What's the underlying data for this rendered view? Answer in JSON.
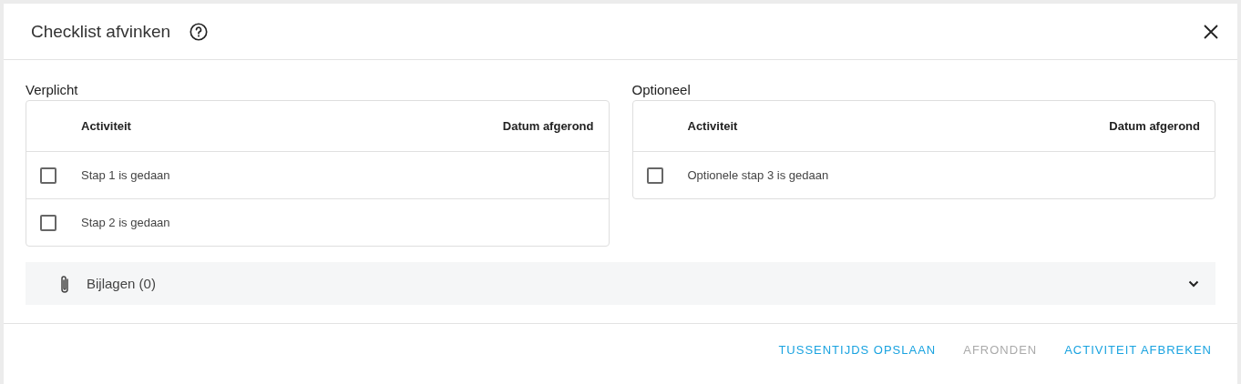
{
  "dialog": {
    "title": "Checklist afvinken"
  },
  "sections": [
    {
      "title": "Verplicht",
      "columns": [
        "Activiteit",
        "Datum afgerond"
      ],
      "rows": [
        {
          "activity": "Stap 1 is gedaan",
          "checked": false
        },
        {
          "activity": "Stap 2 is gedaan",
          "checked": false
        }
      ]
    },
    {
      "title": "Optioneel",
      "columns": [
        "Activiteit",
        "Datum afgerond"
      ],
      "rows": [
        {
          "activity": "Optionele stap 3 is gedaan",
          "checked": false
        }
      ]
    }
  ],
  "attachments": {
    "label": "Bijlagen (0)",
    "expanded": false
  },
  "buttons": [
    {
      "label": "TUSSENTIJDS OPSLAAN",
      "disabled": false
    },
    {
      "label": "AFRONDEN",
      "disabled": true
    },
    {
      "label": "ACTIVITEIT AFBREKEN",
      "disabled": false
    }
  ]
}
